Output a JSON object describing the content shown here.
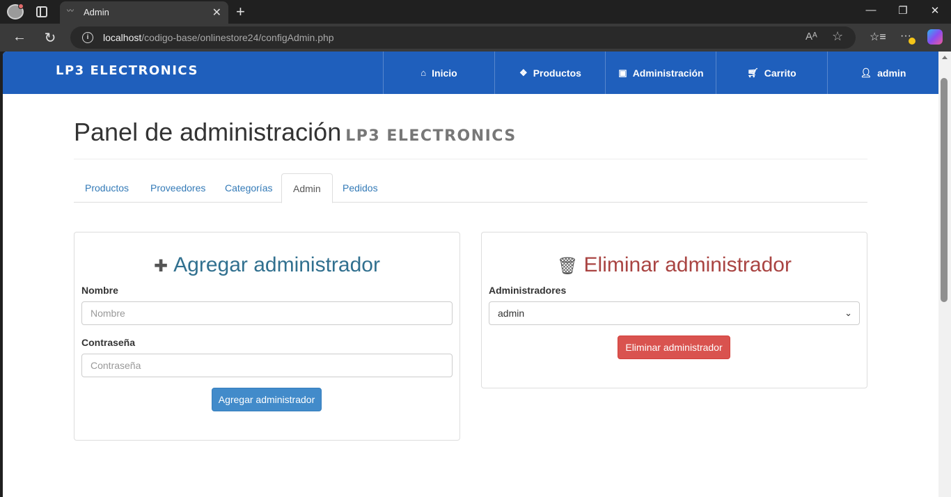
{
  "browser": {
    "tab_title": "Admin",
    "url_host": "localhost",
    "url_path": "/codigo-base/onlinestore24/configAdmin.php"
  },
  "navbar": {
    "brand": "LP3 ELECTRONICS",
    "items": [
      {
        "label": "Inicio",
        "icon": "home-icon"
      },
      {
        "label": "Productos",
        "icon": "dropbox-icon"
      },
      {
        "label": "Administración",
        "icon": "briefcase-icon"
      },
      {
        "label": "Carrito",
        "icon": "cart-icon"
      },
      {
        "label": "admin",
        "icon": "user-icon"
      }
    ],
    "color": "#1f5fbc"
  },
  "page": {
    "title": "Panel de administración",
    "brand": "LP3 ELECTRONICS"
  },
  "tabs": [
    {
      "label": "Productos",
      "active": false
    },
    {
      "label": "Proveedores",
      "active": false
    },
    {
      "label": "Categorías",
      "active": false
    },
    {
      "label": "Admin",
      "active": true
    },
    {
      "label": "Pedidos",
      "active": false
    }
  ],
  "add_admin": {
    "heading": "Agregar administrador",
    "name_label": "Nombre",
    "name_placeholder": "Nombre",
    "password_label": "Contraseña",
    "password_placeholder": "Contraseña",
    "submit_label": "Agregar administrador"
  },
  "delete_admin": {
    "heading": "Eliminar administrador",
    "select_label": "Administradores",
    "selected": "admin",
    "submit_label": "Eliminar administrador"
  },
  "colors": {
    "primary_button": "#428bca",
    "danger_button": "#d9534f",
    "add_heading": "#31708f",
    "delete_heading": "#a94442"
  }
}
